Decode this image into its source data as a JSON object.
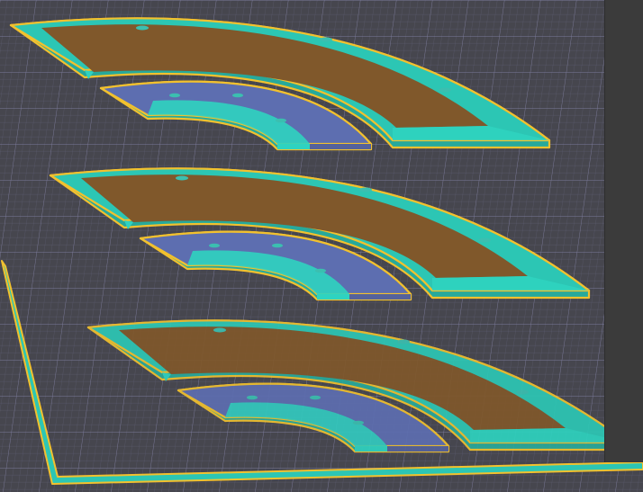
{
  "viewport": {
    "background_color": "#46464e",
    "grid_minor_color": "#6f6e8c",
    "grid_major_color": "#8a89b0",
    "side_panel_color": "#3b3b3b"
  },
  "colors": {
    "selection_outline": "#f2c12e",
    "outer_shell": "#2cc6b4",
    "outer_shell_side": "#27a99b",
    "outer_top_face": "#80582b",
    "inner_top_face": "#5d6eb0",
    "inner_top_face_dark": "#55629c",
    "inner_step": "#2fd3c0",
    "hole": "#3bbfb0"
  },
  "scene": {
    "part_groups": [
      {
        "id": "group-1",
        "outer_holes": 3,
        "inner_holes": 3
      },
      {
        "id": "group-2",
        "outer_holes": 3,
        "inner_holes": 3
      },
      {
        "id": "group-3",
        "outer_holes": 3,
        "inner_holes": 3
      }
    ],
    "build_plate": {
      "selected": true
    }
  }
}
